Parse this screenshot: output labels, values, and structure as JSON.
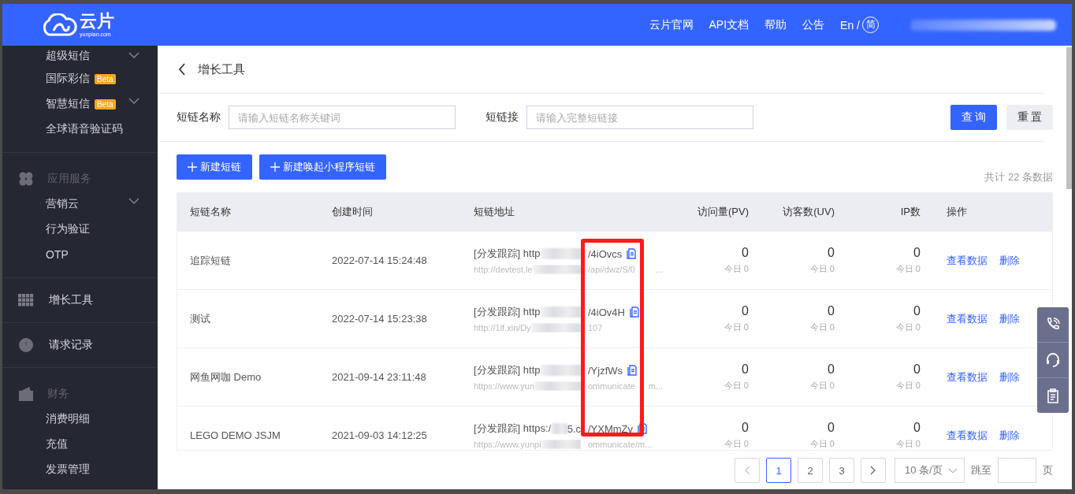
{
  "header": {
    "logo_text": "云片",
    "logo_subtext": "yunpian.com",
    "nav": [
      "云片官网",
      "API文档",
      "帮助",
      "公告"
    ],
    "language": {
      "current": "En /",
      "alternate": "简"
    }
  },
  "sidebar": {
    "items": [
      {
        "kind": "sub",
        "label": "超级短信",
        "expanded": false
      },
      {
        "kind": "sub",
        "label": "国际彩信",
        "badge": "Beta"
      },
      {
        "kind": "sub",
        "label": "智慧短信",
        "badge": "Beta",
        "expanded": false
      },
      {
        "kind": "sub",
        "label": "全球语音验证码"
      },
      {
        "kind": "divider"
      },
      {
        "kind": "group",
        "label": "应用服务"
      },
      {
        "kind": "sub",
        "label": "营销云",
        "expanded": false
      },
      {
        "kind": "sub",
        "label": "行为验证"
      },
      {
        "kind": "sub",
        "label": "OTP"
      },
      {
        "kind": "divider"
      },
      {
        "kind": "link",
        "label": "增长工具"
      },
      {
        "kind": "divider"
      },
      {
        "kind": "link",
        "label": "请求记录"
      },
      {
        "kind": "divider"
      },
      {
        "kind": "group",
        "label": "财务"
      },
      {
        "kind": "sub",
        "label": "消费明细"
      },
      {
        "kind": "sub",
        "label": "充值"
      },
      {
        "kind": "sub",
        "label": "发票管理"
      }
    ]
  },
  "page": {
    "title": "增长工具"
  },
  "filters": [
    {
      "label": "短链名称",
      "placeholder": "请输入短链名称关键词"
    },
    {
      "label": "短链接",
      "placeholder": "请输入完整短链接"
    }
  ],
  "filter_buttons": [
    {
      "label": "查 询",
      "kind": "primary"
    },
    {
      "label": "重 置",
      "kind": "default"
    }
  ],
  "create_buttons": [
    "新建短链",
    "新建唤起小程序短链"
  ],
  "total_text": "共计 22 条数据",
  "table": {
    "columns": [
      "短链名称",
      "创建时间",
      "短链地址",
      "访问量(PV)",
      "访客数(UV)",
      "IP数",
      "操作"
    ],
    "rows": [
      {
        "name": "追踪短链",
        "created": "2022-07-14 15:24:48",
        "short_prefix": "[分发跟踪] http",
        "short_suffix": "/4iOvcs",
        "long_prefix": "http://devtest.le",
        "long_suffix": "/api/dwz/S/0",
        "long_tail": "...",
        "pv": "0",
        "pv_today": "今日 0",
        "uv": "0",
        "uv_today": "今日 0",
        "ip": "0",
        "ip_today": "今日 0",
        "actions": [
          "查看数据",
          "删除"
        ]
      },
      {
        "name": "测试",
        "created": "2022-07-14 15:23:38",
        "short_prefix": "[分发跟踪] http",
        "short_suffix": "/4iOv4H",
        "long_prefix": "http://1lf.xin/Dy",
        "long_suffix": "107",
        "pv": "0",
        "pv_today": "今日 0",
        "uv": "0",
        "uv_today": "今日 0",
        "ip": "0",
        "ip_today": "今日 0",
        "actions": [
          "查看数据",
          "删除"
        ]
      },
      {
        "name": "网鱼网咖 Demo",
        "created": "2021-09-14 23:11:48",
        "short_prefix": "[分发跟踪] http",
        "short_suffix": "/YjzfWs",
        "long_prefix": "https://www.yun",
        "long_suffix": "ommunicate",
        "long_tail": "m...",
        "pv": "0",
        "pv_today": "今日 0",
        "uv": "0",
        "uv_today": "今日 0",
        "ip": "0",
        "ip_today": "今日 0",
        "actions": [
          "查看数据",
          "删除"
        ]
      },
      {
        "name": "LEGO DEMO JSJM",
        "created": "2021-09-03 14:12:25",
        "short_prefix": "[分发跟踪] https:/",
        "short_middle": "5.c",
        "short_suffix": "/YXMmZv",
        "long_prefix": "https://www.yunpi",
        "long_suffix": "ommunicate/m...",
        "pv": "0",
        "pv_today": "今日 0",
        "uv": "0",
        "uv_today": "今日 0",
        "ip": "0",
        "ip_today": "今日 0",
        "actions": [
          "查看数据",
          "删除"
        ]
      }
    ]
  },
  "pagination": {
    "pages": [
      {
        "label": "1",
        "selected": true
      },
      {
        "label": "2",
        "selected": false
      },
      {
        "label": "3",
        "selected": false
      }
    ],
    "page_size": "10 条/页",
    "jump_label": "跳至",
    "jump_suffix": "页"
  }
}
